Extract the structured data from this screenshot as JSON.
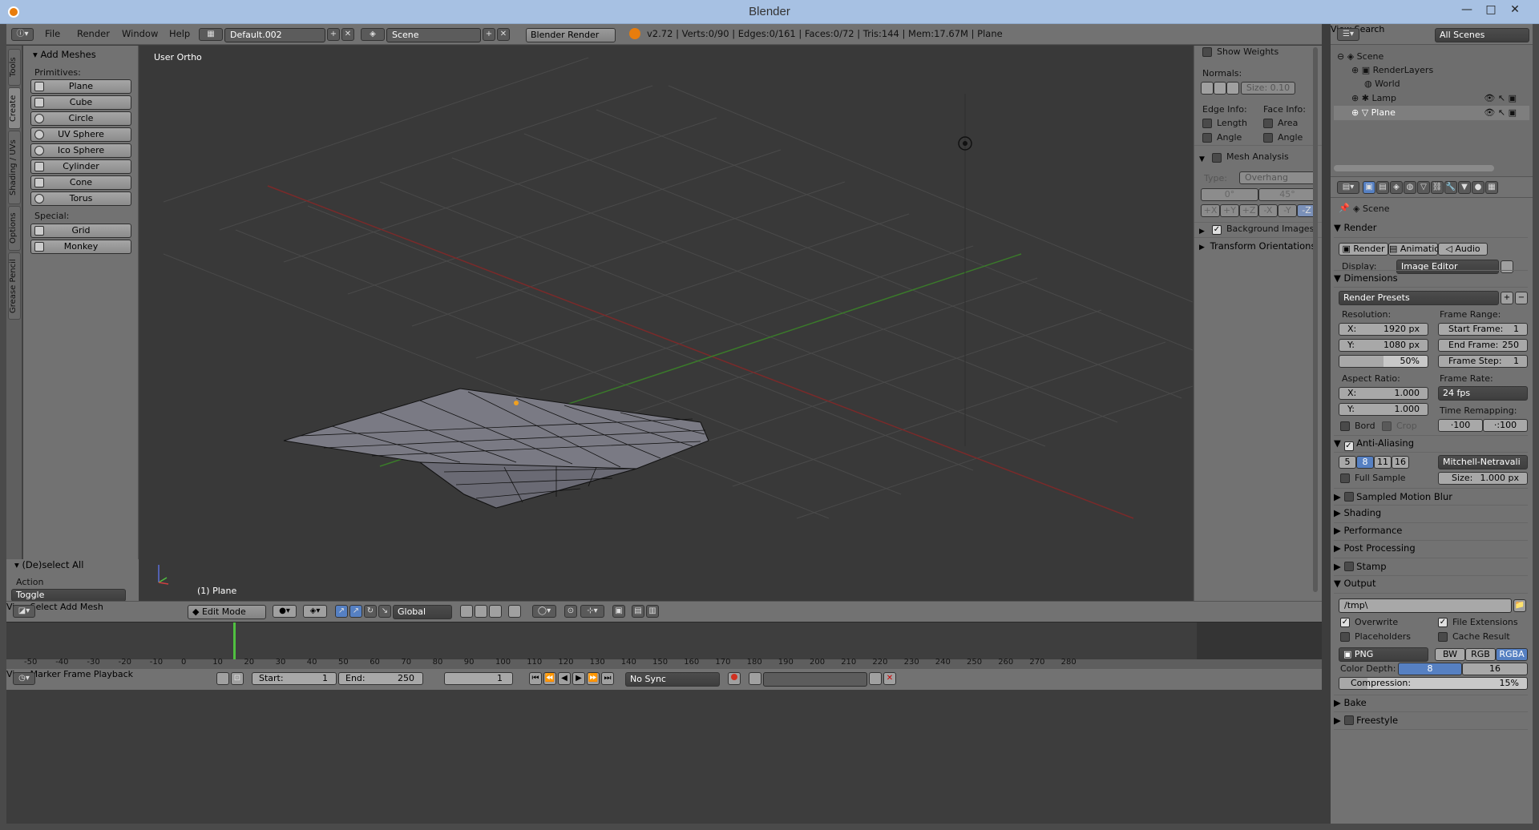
{
  "window": {
    "title": "Blender"
  },
  "info_header": {
    "menus": [
      "File",
      "Render",
      "Window",
      "Help"
    ],
    "layout": "Default.002",
    "scene": "Scene",
    "engine": "Blender Render",
    "stats": "v2.72 | Verts:0/90 | Edges:0/161 | Faces:0/72 | Tris:144 | Mem:17.67M | Plane"
  },
  "tool_tabs": [
    "Tools",
    "Create",
    "Shading / UVs",
    "Options",
    "Grease Pencil"
  ],
  "tool_shelf": {
    "panel_title": "Add Meshes",
    "primitives_label": "Primitives:",
    "primitives": [
      "Plane",
      "Cube",
      "Circle",
      "UV Sphere",
      "Ico Sphere",
      "Cylinder",
      "Cone",
      "Torus"
    ],
    "special_label": "Special:",
    "special": [
      "Grid",
      "Monkey"
    ],
    "operator_title": "(De)select All",
    "action_label": "Action",
    "action_value": "Toggle"
  },
  "viewport": {
    "view_name": "User Ortho",
    "object_label": "(1) Plane"
  },
  "n_panel": {
    "show_weights": "Show Weights",
    "normals_label": "Normals:",
    "normals_size": "Size:  0.10",
    "edge_info": "Edge Info:",
    "face_info": "Face Info:",
    "length": "Length",
    "area": "Area",
    "angle": "Angle",
    "angle2": "Angle",
    "mesh_analysis": "Mesh Analysis",
    "type_label": "Type:",
    "type_value": "Overhang",
    "min_val": "0°",
    "max_val": "45°",
    "axes": [
      "+X",
      "+Y",
      "+Z",
      "-X",
      "-Y",
      "-Z"
    ],
    "background_images": "Background Images",
    "transform_orientations": "Transform Orientations"
  },
  "view3d_header": {
    "menus": [
      "View",
      "Select",
      "Add",
      "Mesh"
    ],
    "mode": "Edit Mode",
    "orientation": "Global"
  },
  "timeline": {
    "ticks": [
      -50,
      -40,
      -30,
      -20,
      -10,
      0,
      10,
      20,
      30,
      40,
      50,
      60,
      70,
      80,
      90,
      100,
      110,
      120,
      130,
      140,
      150,
      160,
      170,
      180,
      190,
      200,
      210,
      220,
      230,
      240,
      250,
      260,
      270,
      280
    ],
    "menus": [
      "View",
      "Marker",
      "Frame",
      "Playback"
    ],
    "start": "Start:",
    "start_val": "1",
    "end": "End:",
    "end_val": "250",
    "current": "1",
    "sync": "No Sync"
  },
  "outliner": {
    "menus": [
      "View",
      "Search"
    ],
    "filter": "All Scenes",
    "items": [
      "Scene",
      "RenderLayers",
      "World",
      "Lamp",
      "Plane"
    ]
  },
  "properties": {
    "context": "Scene",
    "render_title": "Render",
    "render_btns": [
      "Render",
      "Animation",
      "Audio"
    ],
    "display_label": "Display:",
    "display_value": "Image Editor",
    "dimensions": "Dimensions",
    "render_presets": "Render Presets",
    "resolution": "Resolution:",
    "res_x": "X:",
    "res_x_val": "1920 px",
    "res_y": "Y:",
    "res_y_val": "1080 px",
    "res_pct": "50%",
    "frame_range": "Frame Range:",
    "start_frame": "Start Frame:",
    "start_frame_val": "1",
    "end_frame": "End Frame:",
    "end_frame_val": "250",
    "frame_step": "Frame Step:",
    "frame_step_val": "1",
    "aspect_ratio": "Aspect Ratio:",
    "asp_x": "X:",
    "asp_x_val": "1.000",
    "asp_y": "Y:",
    "asp_y_val": "1.000",
    "frame_rate": "Frame Rate:",
    "fps": "24 fps",
    "time_remap": "Time Remapping:",
    "remap_old": "·100",
    "remap_new": "·:100",
    "bord": "Bord",
    "crop": "Crop",
    "anti_aliasing": "Anti-Aliasing",
    "aa_samples": [
      "5",
      "8",
      "11",
      "16"
    ],
    "aa_filter": "Mitchell-Netravali",
    "full_sample": "Full Sample",
    "aa_size": "Size:",
    "aa_size_val": "1.000 px",
    "sections": [
      "Sampled Motion Blur",
      "Shading",
      "Performance",
      "Post Processing",
      "Stamp",
      "Output"
    ],
    "output_path": "/tmp\\",
    "overwrite": "Overwrite",
    "file_extensions": "File Extensions",
    "placeholders": "Placeholders",
    "cache_result": "Cache Result",
    "format": "PNG",
    "color_modes": [
      "BW",
      "RGB",
      "RGBA"
    ],
    "color_depth": "Color Depth:",
    "depths": [
      "8",
      "16"
    ],
    "compression": "Compression:",
    "compression_val": "15%",
    "bake": "Bake",
    "freestyle": "Freestyle"
  }
}
